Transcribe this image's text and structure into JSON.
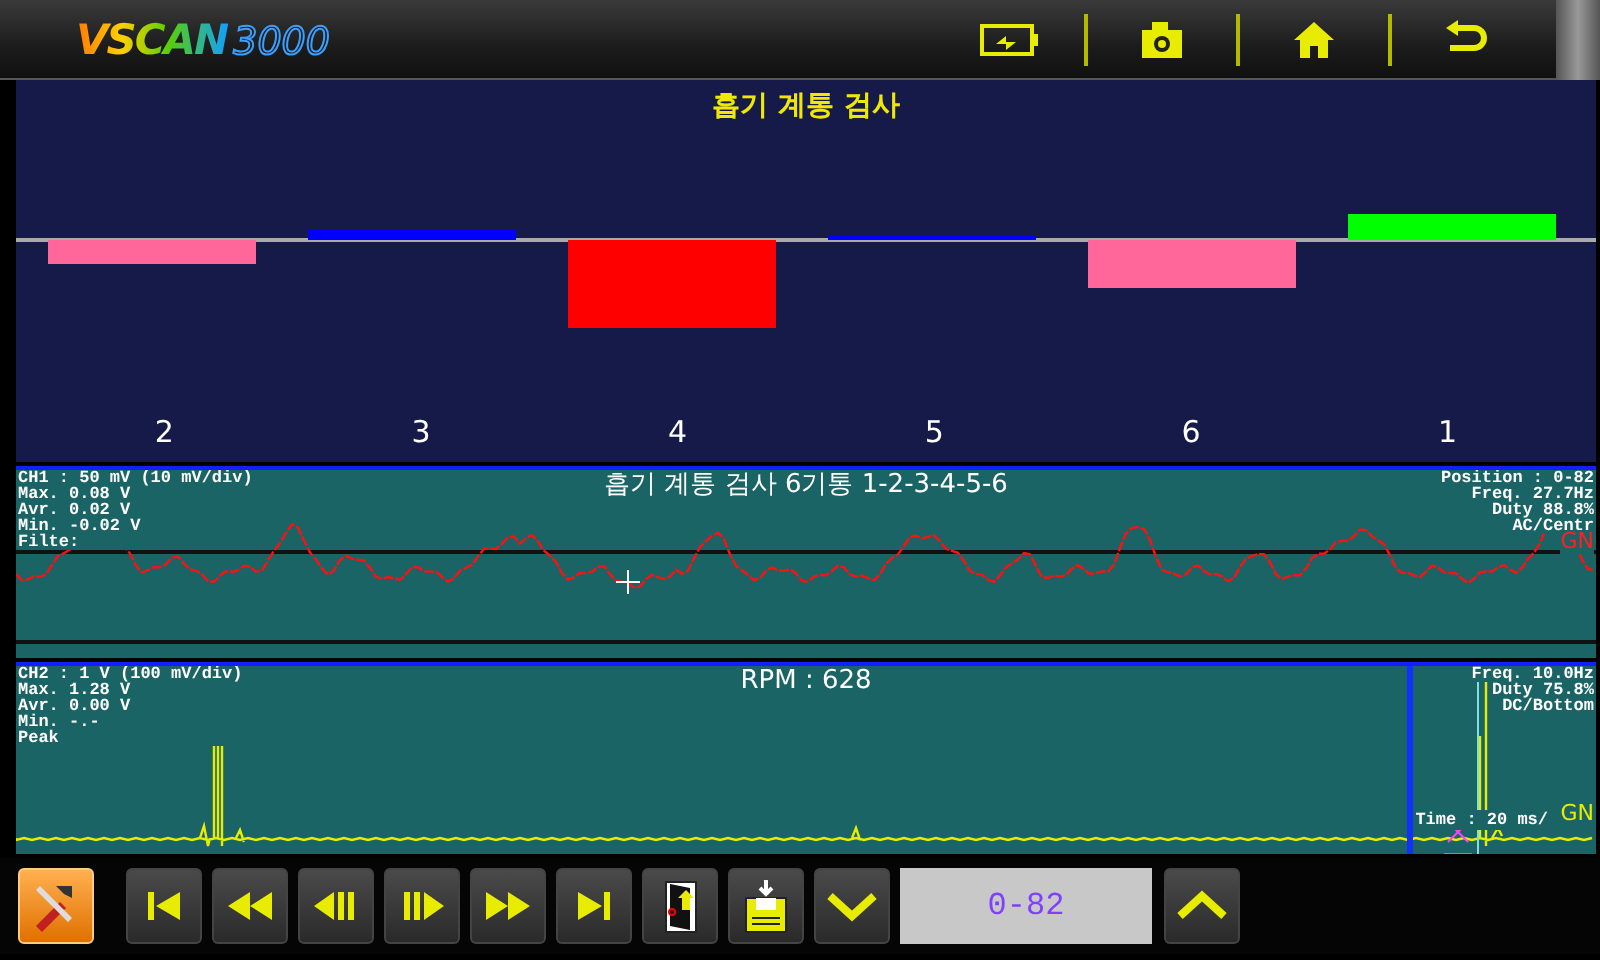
{
  "header": {
    "logo": "VSCAN",
    "logo_number": "3000"
  },
  "bar_chart": {
    "title": "흡기 계통 검사",
    "cylinders": [
      {
        "label": "2",
        "color": "#ff6699"
      },
      {
        "label": "3",
        "color": "#0000ff"
      },
      {
        "label": "4",
        "color": "#ff0000"
      },
      {
        "label": "5",
        "color": "#0000ff"
      },
      {
        "label": "6",
        "color": "#ff6699"
      },
      {
        "label": "1",
        "color": "#00ff00"
      }
    ]
  },
  "scopes": [
    {
      "kind": "wave",
      "title": "흡기 계통 검사 6기통 1-2-3-4-5-6",
      "info_left": [
        "CH1 : 50 mV (10 mV/div)",
        "Max. 0.08 V",
        "Avr. 0.02 V",
        "Min. -0.02 V",
        "Filte:"
      ],
      "info_right": [
        "Position : 0-82",
        "Freq. 27.7Hz",
        "Duty 88.8%",
        "AC/Centr"
      ],
      "gnd_marker": "GN"
    },
    {
      "kind": "pulse",
      "title": "RPM : 628",
      "info_left": [
        "CH2 : 1 V (100 mV/div)",
        "Max. 1.28 V",
        "Avr. 0.00 V",
        "Min. -.-",
        "Peak"
      ],
      "info_right": [
        "Freq. 10.0Hz",
        "Duty 75.8%",
        "DC/Bottom"
      ],
      "time_label": "Time : 20 ms/",
      "gnd_marker": "GN"
    }
  ],
  "toolbar": {
    "position_display": "0-82"
  }
}
